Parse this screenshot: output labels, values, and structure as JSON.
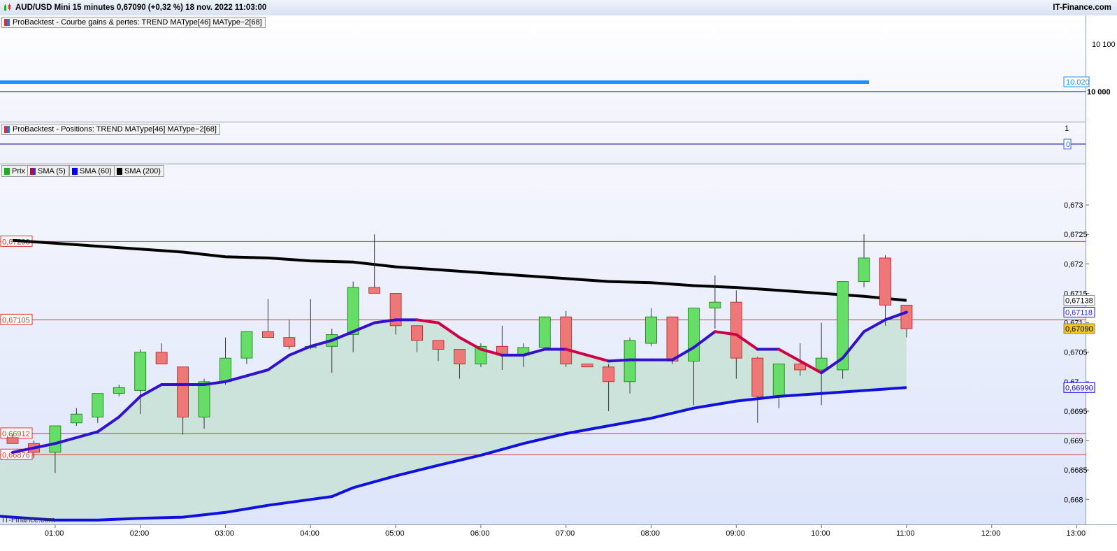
{
  "header": {
    "title": "AUD/USD Mini 15 minutes 0,67090 (+0,32 %) 18 nov. 2022 11:03:00",
    "brand": "IT-Finance.com"
  },
  "panel_equity": {
    "legend": "ProBacktest - Courbe gains & pertes: TREND MAType[46] MAType−2[68]",
    "ticks": [
      "10 100",
      "10 000"
    ],
    "current_label": "10.020",
    "colors": {
      "equity": "#1e90ff",
      "baseline": "#0000aa"
    }
  },
  "panel_positions": {
    "legend": "ProBacktest - Positions: TREND MAType[46] MAType−2[68]",
    "ticks": [
      "1"
    ],
    "current_label": "0"
  },
  "panel_price": {
    "legend": [
      {
        "label": "Prix",
        "color": "#22aa22"
      },
      {
        "label": "SMA (5)",
        "color": "#cc0033"
      },
      {
        "label": "SMA (60)",
        "color": "#0000ee"
      },
      {
        "label": "SMA (200)",
        "color": "#000000"
      }
    ],
    "watermark": "IT-Finance.com",
    "hlines": [
      "0,67238",
      "0,67105",
      "0,66912",
      "0,66876"
    ],
    "price_ticks": [
      "0,673",
      "0,6725",
      "0,672",
      "0,6715",
      "0,671",
      "0,6705",
      "0,67",
      "0,6695",
      "0,669",
      "0,6685",
      "0,668"
    ],
    "axis_labels": [
      {
        "text": "0,67138",
        "color": "#000000",
        "bg": "#ffffff"
      },
      {
        "text": "0,67118",
        "color": "#2222cc",
        "bg": "#ffffff"
      },
      {
        "text": "0,67090",
        "color": "#000000",
        "bg": "#f5c518"
      },
      {
        "text": "0,66990",
        "color": "#0000ee",
        "bg": "#ffffff"
      }
    ],
    "time_ticks": [
      "01:00",
      "02:00",
      "03:00",
      "04:00",
      "05:00",
      "06:00",
      "07:00",
      "08:00",
      "09:00",
      "10:00",
      "11:00",
      "12:00",
      "13:00"
    ]
  },
  "chart_data": {
    "type": "candlestick",
    "instrument": "AUD/USD Mini",
    "interval": "15 minutes",
    "ylim": [
      0.6676,
      0.6735
    ],
    "x_range": [
      "00:30",
      "13:15"
    ],
    "candles": [
      {
        "t": "00:30",
        "o": 0.66905,
        "h": 0.6691,
        "l": 0.66895,
        "c": 0.66895
      },
      {
        "t": "00:45",
        "o": 0.66895,
        "h": 0.669,
        "l": 0.6687,
        "c": 0.6688
      },
      {
        "t": "01:00",
        "o": 0.6688,
        "h": 0.66925,
        "l": 0.66845,
        "c": 0.66925
      },
      {
        "t": "01:15",
        "o": 0.6693,
        "h": 0.66955,
        "l": 0.66925,
        "c": 0.66945
      },
      {
        "t": "01:30",
        "o": 0.6694,
        "h": 0.6698,
        "l": 0.6693,
        "c": 0.6698
      },
      {
        "t": "01:45",
        "o": 0.6698,
        "h": 0.66995,
        "l": 0.66975,
        "c": 0.6699
      },
      {
        "t": "02:00",
        "o": 0.66985,
        "h": 0.67055,
        "l": 0.66945,
        "c": 0.6705
      },
      {
        "t": "02:15",
        "o": 0.6705,
        "h": 0.67065,
        "l": 0.6703,
        "c": 0.6703
      },
      {
        "t": "02:30",
        "o": 0.67025,
        "h": 0.67025,
        "l": 0.6691,
        "c": 0.6694
      },
      {
        "t": "02:45",
        "o": 0.6694,
        "h": 0.67005,
        "l": 0.6692,
        "c": 0.67
      },
      {
        "t": "03:00",
        "o": 0.67,
        "h": 0.67075,
        "l": 0.66995,
        "c": 0.6704
      },
      {
        "t": "03:15",
        "o": 0.6704,
        "h": 0.67085,
        "l": 0.6703,
        "c": 0.67085
      },
      {
        "t": "03:30",
        "o": 0.67085,
        "h": 0.6714,
        "l": 0.67075,
        "c": 0.67075
      },
      {
        "t": "03:45",
        "o": 0.67075,
        "h": 0.67105,
        "l": 0.67055,
        "c": 0.6706
      },
      {
        "t": "04:00",
        "o": 0.6706,
        "h": 0.6714,
        "l": 0.67055,
        "c": 0.6706
      },
      {
        "t": "04:15",
        "o": 0.6706,
        "h": 0.6709,
        "l": 0.67015,
        "c": 0.6708
      },
      {
        "t": "04:30",
        "o": 0.6708,
        "h": 0.6717,
        "l": 0.6705,
        "c": 0.6716
      },
      {
        "t": "04:45",
        "o": 0.6716,
        "h": 0.6725,
        "l": 0.6716,
        "c": 0.6715
      },
      {
        "t": "05:00",
        "o": 0.6715,
        "h": 0.6715,
        "l": 0.6708,
        "c": 0.67095
      },
      {
        "t": "05:15",
        "o": 0.67095,
        "h": 0.67095,
        "l": 0.6705,
        "c": 0.6707
      },
      {
        "t": "05:30",
        "o": 0.6707,
        "h": 0.6707,
        "l": 0.67035,
        "c": 0.67055
      },
      {
        "t": "05:45",
        "o": 0.67055,
        "h": 0.67055,
        "l": 0.67005,
        "c": 0.6703
      },
      {
        "t": "06:00",
        "o": 0.6703,
        "h": 0.67065,
        "l": 0.67025,
        "c": 0.6706
      },
      {
        "t": "06:15",
        "o": 0.6706,
        "h": 0.67095,
        "l": 0.6702,
        "c": 0.67045
      },
      {
        "t": "06:30",
        "o": 0.67045,
        "h": 0.67065,
        "l": 0.67025,
        "c": 0.67058
      },
      {
        "t": "06:45",
        "o": 0.67058,
        "h": 0.6711,
        "l": 0.67058,
        "c": 0.6711
      },
      {
        "t": "07:00",
        "o": 0.6711,
        "h": 0.6712,
        "l": 0.67025,
        "c": 0.6703
      },
      {
        "t": "07:15",
        "o": 0.6703,
        "h": 0.6703,
        "l": 0.67025,
        "c": 0.67025
      },
      {
        "t": "07:30",
        "o": 0.67025,
        "h": 0.6703,
        "l": 0.6695,
        "c": 0.67
      },
      {
        "t": "07:45",
        "o": 0.67,
        "h": 0.67075,
        "l": 0.6698,
        "c": 0.6707
      },
      {
        "t": "08:00",
        "o": 0.67065,
        "h": 0.67125,
        "l": 0.6706,
        "c": 0.6711
      },
      {
        "t": "08:15",
        "o": 0.6711,
        "h": 0.6711,
        "l": 0.6703,
        "c": 0.67035
      },
      {
        "t": "08:30",
        "o": 0.67035,
        "h": 0.67125,
        "l": 0.6696,
        "c": 0.67125
      },
      {
        "t": "08:45",
        "o": 0.67125,
        "h": 0.6718,
        "l": 0.6709,
        "c": 0.67135
      },
      {
        "t": "09:00",
        "o": 0.67135,
        "h": 0.67155,
        "l": 0.67005,
        "c": 0.6704
      },
      {
        "t": "09:15",
        "o": 0.6704,
        "h": 0.67042,
        "l": 0.6693,
        "c": 0.66975
      },
      {
        "t": "09:30",
        "o": 0.66975,
        "h": 0.6703,
        "l": 0.66955,
        "c": 0.6703
      },
      {
        "t": "09:45",
        "o": 0.6703,
        "h": 0.67065,
        "l": 0.6701,
        "c": 0.6702
      },
      {
        "t": "10:00",
        "o": 0.6702,
        "h": 0.671,
        "l": 0.6696,
        "c": 0.6704
      },
      {
        "t": "10:15",
        "o": 0.6702,
        "h": 0.6717,
        "l": 0.67005,
        "c": 0.6717
      },
      {
        "t": "10:30",
        "o": 0.6717,
        "h": 0.6725,
        "l": 0.6716,
        "c": 0.6721
      },
      {
        "t": "10:45",
        "o": 0.6721,
        "h": 0.67215,
        "l": 0.67095,
        "c": 0.6713
      },
      {
        "t": "11:00",
        "o": 0.6713,
        "h": 0.6713,
        "l": 0.67075,
        "c": 0.6709
      }
    ],
    "series": [
      {
        "name": "SMA (5)",
        "points": [
          [
            "00:30",
            0.6688
          ],
          [
            "01:00",
            0.66895
          ],
          [
            "01:30",
            0.66915
          ],
          [
            "01:45",
            0.6694
          ],
          [
            "02:00",
            0.66975
          ],
          [
            "02:15",
            0.66995
          ],
          [
            "02:30",
            0.66995
          ],
          [
            "02:45",
            0.66995
          ],
          [
            "03:00",
            0.67
          ],
          [
            "03:15",
            0.6701
          ],
          [
            "03:30",
            0.6702
          ],
          [
            "03:45",
            0.67045
          ],
          [
            "04:00",
            0.6706
          ],
          [
            "04:15",
            0.6707
          ],
          [
            "04:30",
            0.67085
          ],
          [
            "04:45",
            0.671
          ],
          [
            "05:00",
            0.67105
          ],
          [
            "05:15",
            0.67105
          ],
          [
            "05:30",
            0.671
          ],
          [
            "05:45",
            0.67075
          ],
          [
            "06:00",
            0.67055
          ],
          [
            "06:15",
            0.67045
          ],
          [
            "06:30",
            0.67045
          ],
          [
            "06:45",
            0.67055
          ],
          [
            "07:00",
            0.67055
          ],
          [
            "07:15",
            0.67045
          ],
          [
            "07:30",
            0.67035
          ],
          [
            "07:45",
            0.67037
          ],
          [
            "08:00",
            0.67037
          ],
          [
            "08:15",
            0.67037
          ],
          [
            "08:30",
            0.67058
          ],
          [
            "08:45",
            0.67085
          ],
          [
            "09:00",
            0.6708
          ],
          [
            "09:15",
            0.67055
          ],
          [
            "09:30",
            0.67055
          ],
          [
            "09:45",
            0.67035
          ],
          [
            "10:00",
            0.67015
          ],
          [
            "10:15",
            0.6704
          ],
          [
            "10:30",
            0.67085
          ],
          [
            "10:45",
            0.67105
          ],
          [
            "11:00",
            0.67118
          ]
        ]
      },
      {
        "name": "SMA (60)",
        "points": [
          [
            "00:00",
            0.66775
          ],
          [
            "00:30",
            0.6677
          ],
          [
            "01:00",
            0.66765
          ],
          [
            "01:30",
            0.66765
          ],
          [
            "02:00",
            0.66768
          ],
          [
            "02:30",
            0.6677
          ],
          [
            "03:00",
            0.66778
          ],
          [
            "03:30",
            0.6679
          ],
          [
            "04:00",
            0.668
          ],
          [
            "04:15",
            0.66805
          ],
          [
            "04:30",
            0.6682
          ],
          [
            "05:00",
            0.6684
          ],
          [
            "05:30",
            0.66858
          ],
          [
            "06:00",
            0.66875
          ],
          [
            "06:30",
            0.66895
          ],
          [
            "07:00",
            0.66912
          ],
          [
            "07:30",
            0.66925
          ],
          [
            "08:00",
            0.66938
          ],
          [
            "08:30",
            0.66955
          ],
          [
            "09:00",
            0.66967
          ],
          [
            "09:30",
            0.66975
          ],
          [
            "10:00",
            0.6698
          ],
          [
            "10:30",
            0.66985
          ],
          [
            "11:00",
            0.6699
          ]
        ]
      },
      {
        "name": "SMA (200)",
        "points": [
          [
            "00:30",
            0.6724
          ],
          [
            "01:00",
            0.67235
          ],
          [
            "01:30",
            0.6723
          ],
          [
            "02:00",
            0.67225
          ],
          [
            "02:30",
            0.6722
          ],
          [
            "03:00",
            0.67212
          ],
          [
            "03:30",
            0.6721
          ],
          [
            "04:00",
            0.67205
          ],
          [
            "04:30",
            0.67203
          ],
          [
            "05:00",
            0.67195
          ],
          [
            "05:30",
            0.6719
          ],
          [
            "06:00",
            0.67185
          ],
          [
            "06:30",
            0.6718
          ],
          [
            "07:00",
            0.67175
          ],
          [
            "07:30",
            0.6717
          ],
          [
            "08:00",
            0.67168
          ],
          [
            "08:30",
            0.67163
          ],
          [
            "09:00",
            0.6716
          ],
          [
            "09:30",
            0.67155
          ],
          [
            "10:00",
            0.6715
          ],
          [
            "10:30",
            0.67145
          ],
          [
            "11:00",
            0.67138
          ]
        ]
      }
    ],
    "hlines": [
      0.67238,
      0.67105,
      0.66912,
      0.66876
    ],
    "equity": {
      "value": 10020,
      "baseline": 10000
    },
    "xlabel": "",
    "ylabel": "",
    "grid": false
  }
}
